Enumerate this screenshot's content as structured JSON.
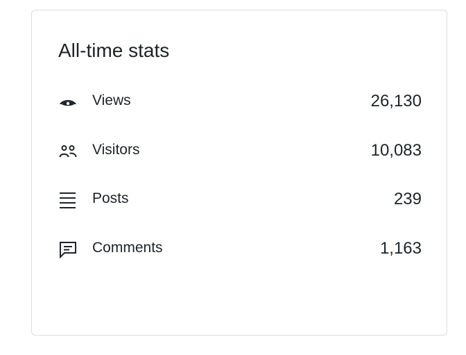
{
  "card": {
    "title": "All-time stats",
    "stats": [
      {
        "icon": "eye-icon",
        "label": "Views",
        "value": "26,130"
      },
      {
        "icon": "people-icon",
        "label": "Visitors",
        "value": "10,083"
      },
      {
        "icon": "list-lines-icon",
        "label": "Posts",
        "value": "239"
      },
      {
        "icon": "comment-icon",
        "label": "Comments",
        "value": "1,163"
      }
    ]
  },
  "colors": {
    "text": "#1d2327",
    "border": "#dcdcde",
    "background": "#ffffff"
  }
}
